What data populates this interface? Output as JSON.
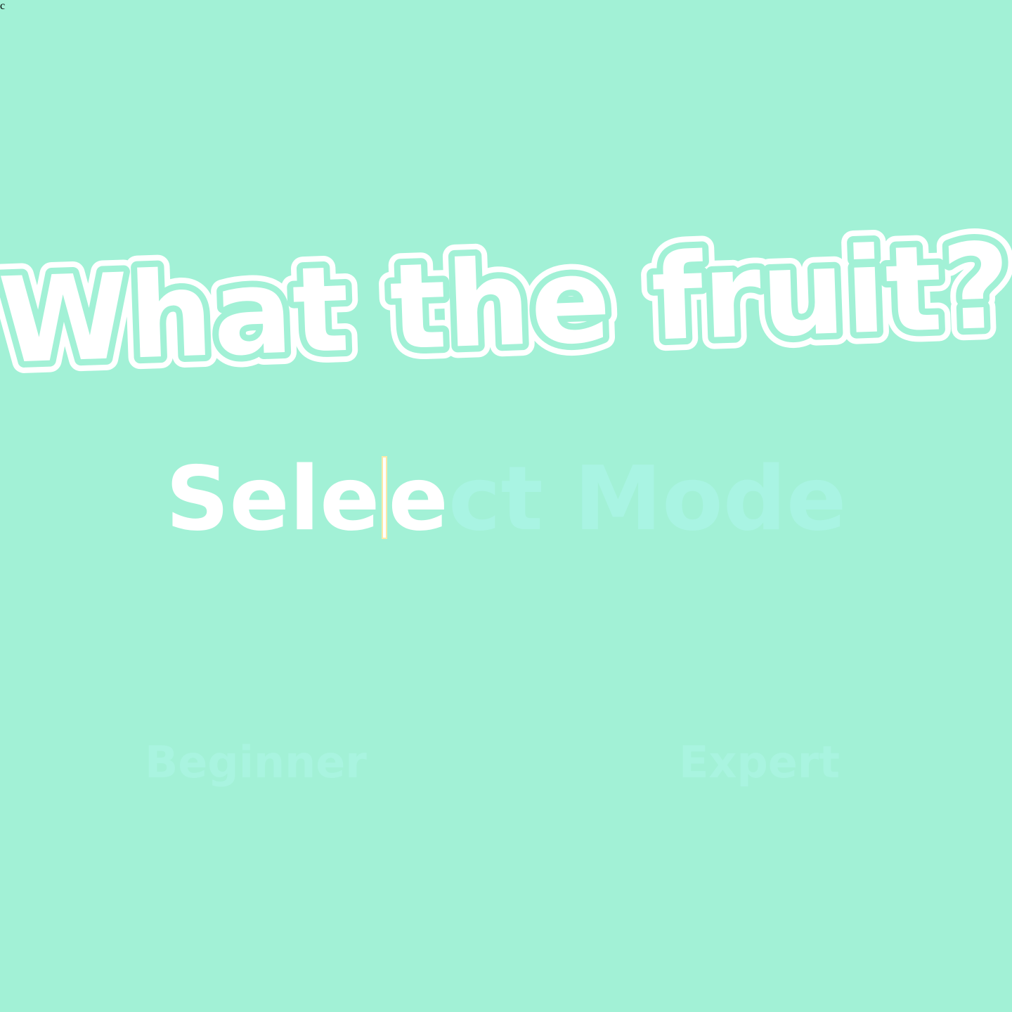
{
  "game": {
    "title": "What the fruit?",
    "colors": {
      "background": "#a2f1d6",
      "title_fill": "#ffffff",
      "title_inner": "#a2f1d6",
      "ghost_text": "#a9f4e3",
      "button_text": "#a9f4e0"
    }
  },
  "mode_select": {
    "heading_typed": "Sele",
    "heading_typed_after_caret": "e",
    "floating_letter": "c",
    "heading_remaining": "ct Mode",
    "options": [
      {
        "label": "Beginner"
      },
      {
        "label": "Expert"
      }
    ]
  }
}
